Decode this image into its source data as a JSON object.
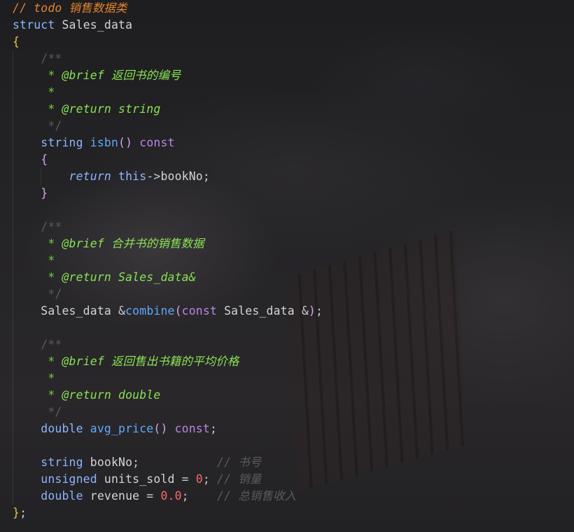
{
  "colors": {
    "comment_todo": "#e2832d",
    "comment": "#5a5a5e",
    "doc": "#8ae254",
    "doc_star": "#71d13e",
    "keyword": "#b986e6",
    "type": "#8fb4ff",
    "ident": "#d4d4d4",
    "func": "#5fa8ff",
    "punct": "#c9c9d2",
    "brace": "#e5c24a",
    "paren": "#d6a3e8",
    "number": "#f66a6a"
  },
  "lines": [
    [
      {
        "t": "// todo 销售数据类",
        "c": "comment_todo",
        "i": true
      }
    ],
    [
      {
        "t": "struct ",
        "c": "type"
      },
      {
        "t": "Sales_data",
        "c": "ident"
      }
    ],
    [
      {
        "t": "{",
        "c": "brace"
      }
    ],
    [
      {
        "t": "    /**",
        "c": "comment"
      }
    ],
    [
      {
        "t": "     * ",
        "c": "doc_star"
      },
      {
        "t": "@brief",
        "c": "doc",
        "i": true
      },
      {
        "t": " 返回书的编号",
        "c": "doc",
        "i": true
      }
    ],
    [
      {
        "t": "     *",
        "c": "doc_star"
      }
    ],
    [
      {
        "t": "     * ",
        "c": "doc_star"
      },
      {
        "t": "@return",
        "c": "doc",
        "i": true
      },
      {
        "t": " string",
        "c": "doc",
        "i": true
      }
    ],
    [
      {
        "t": "     */",
        "c": "comment"
      }
    ],
    [
      {
        "t": "    string ",
        "c": "type"
      },
      {
        "t": "isbn",
        "c": "func"
      },
      {
        "t": "() ",
        "c": "paren"
      },
      {
        "t": "const",
        "c": "keyword"
      }
    ],
    [
      {
        "t": "    {",
        "c": "paren"
      }
    ],
    [
      {
        "t": "        return ",
        "c": "type",
        "i": true
      },
      {
        "t": "this",
        "c": "type"
      },
      {
        "t": "->",
        "c": "punct"
      },
      {
        "t": "bookNo",
        "c": "ident"
      },
      {
        "t": ";",
        "c": "punct"
      }
    ],
    [
      {
        "t": "    }",
        "c": "paren"
      }
    ],
    [],
    [
      {
        "t": "    /**",
        "c": "comment"
      }
    ],
    [
      {
        "t": "     * ",
        "c": "doc_star"
      },
      {
        "t": "@brief",
        "c": "doc",
        "i": true
      },
      {
        "t": " 合并书的销售数据",
        "c": "doc",
        "i": true
      }
    ],
    [
      {
        "t": "     *",
        "c": "doc_star"
      }
    ],
    [
      {
        "t": "     * ",
        "c": "doc_star"
      },
      {
        "t": "@return",
        "c": "doc",
        "i": true
      },
      {
        "t": " Sales_data&",
        "c": "doc",
        "i": true
      }
    ],
    [
      {
        "t": "     */",
        "c": "comment"
      }
    ],
    [
      {
        "t": "    Sales_data ",
        "c": "ident"
      },
      {
        "t": "&",
        "c": "punct"
      },
      {
        "t": "combine",
        "c": "func"
      },
      {
        "t": "(",
        "c": "paren"
      },
      {
        "t": "const ",
        "c": "keyword"
      },
      {
        "t": "Sales_data ",
        "c": "ident"
      },
      {
        "t": "&",
        "c": "punct"
      },
      {
        "t": ")",
        "c": "paren"
      },
      {
        "t": ";",
        "c": "punct"
      }
    ],
    [],
    [
      {
        "t": "    /**",
        "c": "comment"
      }
    ],
    [
      {
        "t": "     * ",
        "c": "doc_star"
      },
      {
        "t": "@brief",
        "c": "doc",
        "i": true
      },
      {
        "t": " 返回售出书籍的平均价格",
        "c": "doc",
        "i": true
      }
    ],
    [
      {
        "t": "     *",
        "c": "doc_star"
      }
    ],
    [
      {
        "t": "     * ",
        "c": "doc_star"
      },
      {
        "t": "@return",
        "c": "doc",
        "i": true
      },
      {
        "t": " double",
        "c": "doc",
        "i": true
      }
    ],
    [
      {
        "t": "     */",
        "c": "comment"
      }
    ],
    [
      {
        "t": "    double ",
        "c": "type"
      },
      {
        "t": "avg_price",
        "c": "func"
      },
      {
        "t": "() ",
        "c": "paren"
      },
      {
        "t": "const",
        "c": "keyword"
      },
      {
        "t": ";",
        "c": "punct"
      }
    ],
    [],
    [
      {
        "t": "    string ",
        "c": "type"
      },
      {
        "t": "bookNo",
        "c": "ident"
      },
      {
        "t": ";           ",
        "c": "punct"
      },
      {
        "t": "// 书号",
        "c": "comment",
        "i": true
      }
    ],
    [
      {
        "t": "    unsigned ",
        "c": "type"
      },
      {
        "t": "units_sold ",
        "c": "ident"
      },
      {
        "t": "= ",
        "c": "punct"
      },
      {
        "t": "0",
        "c": "number"
      },
      {
        "t": "; ",
        "c": "punct"
      },
      {
        "t": "// 销量",
        "c": "comment",
        "i": true
      }
    ],
    [
      {
        "t": "    double ",
        "c": "type"
      },
      {
        "t": "revenue ",
        "c": "ident"
      },
      {
        "t": "= ",
        "c": "punct"
      },
      {
        "t": "0.0",
        "c": "number"
      },
      {
        "t": ";    ",
        "c": "punct"
      },
      {
        "t": "// 总销售收入",
        "c": "comment",
        "i": true
      }
    ],
    [
      {
        "t": "}",
        "c": "brace"
      },
      {
        "t": ";",
        "c": "punct"
      }
    ]
  ]
}
